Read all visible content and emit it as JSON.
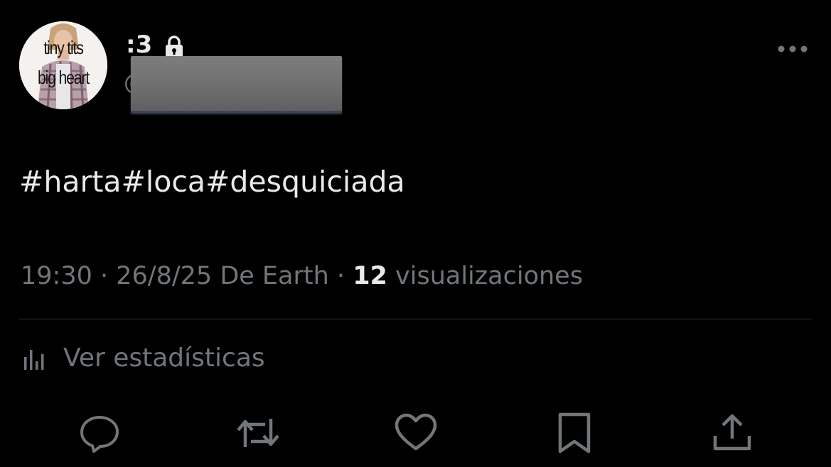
{
  "author": {
    "display_name": ":3",
    "handle_prefix": "@",
    "avatar_text_line1": "tiny tits",
    "avatar_text_line2": "big heart",
    "protected_icon": "lock-icon"
  },
  "tweet": {
    "text": "#harta#loca#desquiciada",
    "time": "19:30",
    "separator1": " · ",
    "date_source": "26/8/25 De Earth",
    "separator2": " · ",
    "views_count": "12",
    "views_label": " visualizaciones"
  },
  "stats": {
    "label": "Ver estadísticas",
    "icon": "bar-chart-icon"
  },
  "actions": {
    "reply_icon": "reply-icon",
    "retweet_icon": "retweet-icon",
    "like_icon": "heart-icon",
    "bookmark_icon": "bookmark-icon",
    "share_icon": "share-icon"
  },
  "colors": {
    "background": "#000000",
    "primary_text": "#e7e9ea",
    "secondary_text": "#71767b",
    "divider": "#2f3336"
  }
}
